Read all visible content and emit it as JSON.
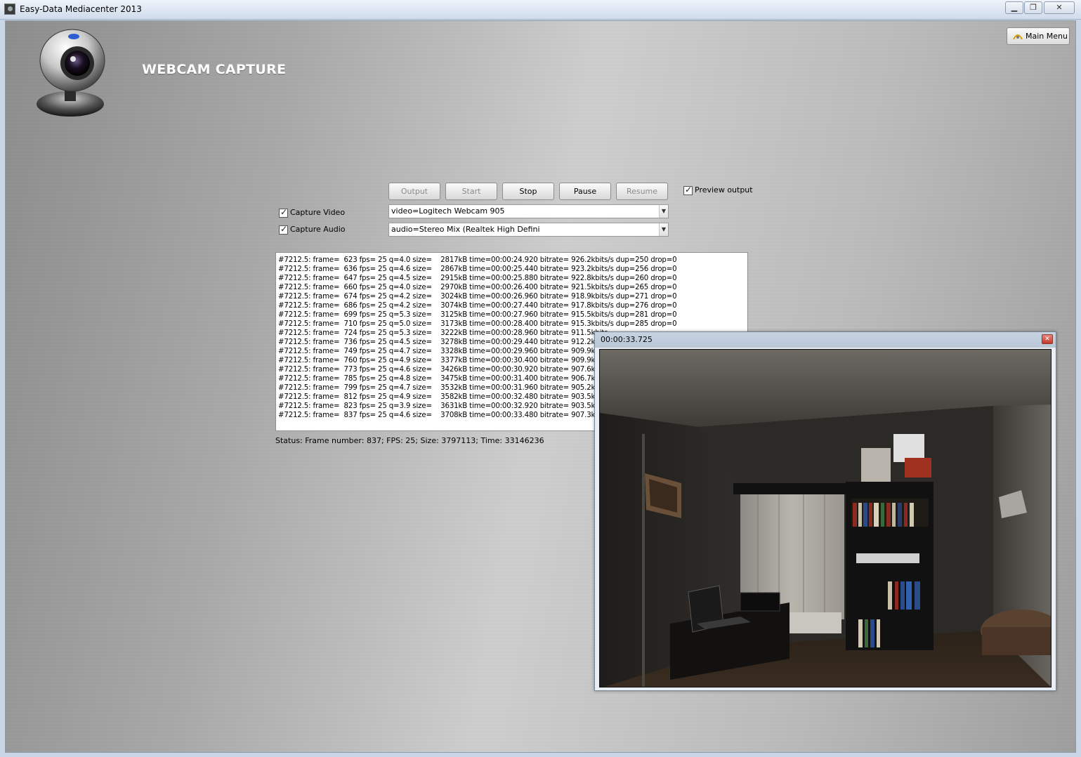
{
  "window": {
    "title": "Easy-Data Mediacenter 2013",
    "minimize": "▁",
    "maximize": "❐",
    "close": "✕"
  },
  "page": {
    "title": "WEBCAM CAPTURE",
    "main_menu_label": "Main Menu"
  },
  "toolbar": {
    "output": "Output",
    "start": "Start",
    "stop": "Stop",
    "pause": "Pause",
    "resume": "Resume",
    "preview_output": "Preview output"
  },
  "capture": {
    "video_label": "Capture Video",
    "video_value": "video=Logitech Webcam 905",
    "audio_label": "Capture Audio",
    "audio_value": "audio=Stereo Mix (Realtek High Defini",
    "arrow": "▼"
  },
  "log": {
    "lines": [
      "#7212.5: frame=  623 fps= 25 q=4.0 size=    2817kB time=00:00:24.920 bitrate= 926.2kbits/s dup=250 drop=0",
      "#7212.5: frame=  636 fps= 25 q=4.6 size=    2867kB time=00:00:25.440 bitrate= 923.2kbits/s dup=256 drop=0",
      "#7212.5: frame=  647 fps= 25 q=4.5 size=    2915kB time=00:00:25.880 bitrate= 922.8kbits/s dup=260 drop=0",
      "#7212.5: frame=  660 fps= 25 q=4.0 size=    2970kB time=00:00:26.400 bitrate= 921.5kbits/s dup=265 drop=0",
      "#7212.5: frame=  674 fps= 25 q=4.2 size=    3024kB time=00:00:26.960 bitrate= 918.9kbits/s dup=271 drop=0",
      "#7212.5: frame=  686 fps= 25 q=4.2 size=    3074kB time=00:00:27.440 bitrate= 917.8kbits/s dup=276 drop=0",
      "#7212.5: frame=  699 fps= 25 q=5.3 size=    3125kB time=00:00:27.960 bitrate= 915.5kbits/s dup=281 drop=0",
      "#7212.5: frame=  710 fps= 25 q=5.0 size=    3173kB time=00:00:28.400 bitrate= 915.3kbits/s dup=285 drop=0",
      "#7212.5: frame=  724 fps= 25 q=5.3 size=    3222kB time=00:00:28.960 bitrate= 911.5kbits",
      "#7212.5: frame=  736 fps= 25 q=4.5 size=    3278kB time=00:00:29.440 bitrate= 912.2kbits",
      "#7212.5: frame=  749 fps= 25 q=4.7 size=    3328kB time=00:00:29.960 bitrate= 909.9kbits",
      "#7212.5: frame=  760 fps= 25 q=4.9 size=    3377kB time=00:00:30.400 bitrate= 909.9kbits",
      "#7212.5: frame=  773 fps= 25 q=4.6 size=    3426kB time=00:00:30.920 bitrate= 907.6kbits",
      "#7212.5: frame=  785 fps= 25 q=4.8 size=    3475kB time=00:00:31.400 bitrate= 906.7kbits",
      "#7212.5: frame=  799 fps= 25 q=4.7 size=    3532kB time=00:00:31.960 bitrate= 905.2kbits",
      "#7212.5: frame=  812 fps= 25 q=4.9 size=    3582kB time=00:00:32.480 bitrate= 903.5kbits",
      "#7212.5: frame=  823 fps= 25 q=3.9 size=    3631kB time=00:00:32.920 bitrate= 903.5kbits",
      "#7212.5: frame=  837 fps= 25 q=4.6 size=    3708kB time=00:00:33.480 bitrate= 907.3kbits"
    ]
  },
  "status": {
    "text": "Status:  Frame number: 837; FPS: 25; Size: 3797113; Time: 33146236"
  },
  "preview": {
    "time": "00:00:33.725",
    "close": "✕"
  }
}
